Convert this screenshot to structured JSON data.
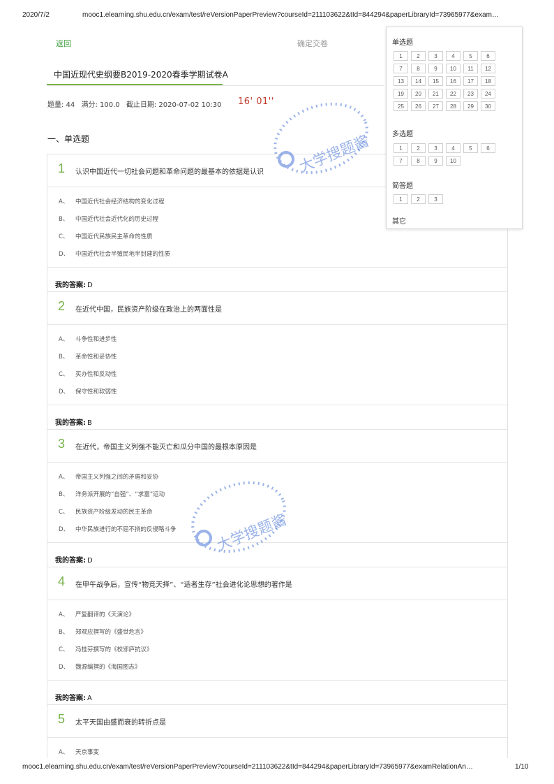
{
  "print_header": {
    "date": "2020/7/2",
    "url": "mooc1.elearning.shu.edu.cn/exam/test/reVersionPaperPreview?courseId=211103622&tId=844294&paperLibraryId=73965977&exam…"
  },
  "print_footer": {
    "url": "mooc1.elearning.shu.edu.cn/exam/test/reVersionPaperPreview?courseId=211103622&tId=844294&paperLibraryId=73965977&examRelationAn…",
    "page": "1/10"
  },
  "toolbar": {
    "back": "返回",
    "submit": "确定交卷"
  },
  "paper": {
    "title": "中国近现代史纲要B2019-2020春季学期试卷A",
    "count_label": "题量: 44",
    "score_label": "满分: 100.0",
    "deadline_label": "截止日期: 2020-07-02 10:30",
    "timer": "16' 01''"
  },
  "section": {
    "heading": "一、单选题"
  },
  "answer_label": "我的答案:",
  "questions": [
    {
      "num": "1",
      "text": "认识中国近代一切社会问题和革命问题的最基本的依据是认识",
      "options": [
        {
          "letter": "A、",
          "text": "中国近代社会经济结构的变化过程"
        },
        {
          "letter": "B、",
          "text": "中国近代社会近代化的历史过程"
        },
        {
          "letter": "C、",
          "text": "中国近代民族民主革命的性质"
        },
        {
          "letter": "D、",
          "text": "中国近代社会半殖民地半封建的性质"
        }
      ],
      "answer": "D"
    },
    {
      "num": "2",
      "text": "在近代中国，民族资产阶级在政治上的两面性是",
      "options": [
        {
          "letter": "A、",
          "text": "斗争性和进步性"
        },
        {
          "letter": "B、",
          "text": "革命性和妥协性"
        },
        {
          "letter": "C、",
          "text": "买办性和反动性"
        },
        {
          "letter": "D、",
          "text": "保守性和软弱性"
        }
      ],
      "answer": "B"
    },
    {
      "num": "3",
      "text": "在近代，帝国主义列强不能灭亡和瓜分中国的最根本原因是",
      "options": [
        {
          "letter": "A、",
          "text": "帝国主义列强之间的矛盾和妥协"
        },
        {
          "letter": "B、",
          "text": "洋务派开展的“自强”、“求富”运动"
        },
        {
          "letter": "C、",
          "text": "民族资产阶级发动的民主革命"
        },
        {
          "letter": "D、",
          "text": "中华民族进行的不屈不挠的反侵略斗争"
        }
      ],
      "answer": "D"
    },
    {
      "num": "4",
      "text": "在甲午战争后，宣传“物竞天择”、“适者生存”社会进化论思想的著作是",
      "options": [
        {
          "letter": "A、",
          "text": "严复翻译的《天演论》"
        },
        {
          "letter": "B、",
          "text": "郑观应撰写的《盛世危言》"
        },
        {
          "letter": "C、",
          "text": "冯桂芬撰写的《校邠庐抗议》"
        },
        {
          "letter": "D、",
          "text": "魏源编撰的《海国图志》"
        }
      ],
      "answer": "A"
    },
    {
      "num": "5",
      "text": "太平天国由盛而衰的转折点是",
      "options": [
        {
          "letter": "A、",
          "text": "天京事变"
        }
      ]
    }
  ],
  "nav": {
    "single_label": "单选题",
    "single": [
      "1",
      "2",
      "3",
      "4",
      "5",
      "6",
      "7",
      "8",
      "9",
      "10",
      "11",
      "12",
      "13",
      "14",
      "15",
      "16",
      "17",
      "18",
      "19",
      "20",
      "21",
      "22",
      "23",
      "24",
      "25",
      "26",
      "27",
      "28",
      "29",
      "30"
    ],
    "multi_label": "多选题",
    "multi": [
      "1",
      "2",
      "3",
      "4",
      "5",
      "6",
      "7",
      "8",
      "9",
      "10"
    ],
    "short_label": "简答题",
    "short": [
      "1",
      "2",
      "3"
    ],
    "other_label": "其它"
  },
  "watermark": {
    "text": "大学搜题酱",
    "color": "#4a76d8"
  }
}
